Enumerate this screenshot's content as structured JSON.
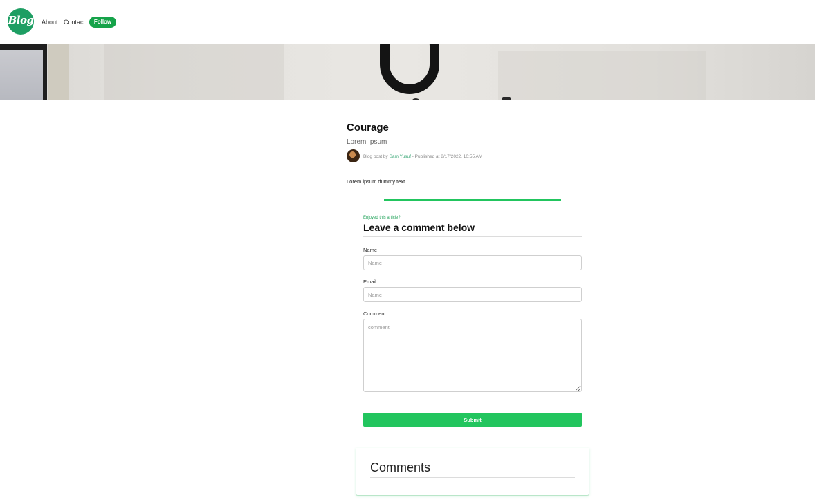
{
  "header": {
    "logo_text": "Blog",
    "nav": [
      {
        "label": "About"
      },
      {
        "label": "Contact"
      }
    ],
    "follow_label": "Follow"
  },
  "post": {
    "title": "Courage",
    "subtitle": "Lorem Ipsum",
    "meta_prefix": "Blog post by ",
    "author": "Sam Yusuf",
    "meta_suffix": " - Published at 8/17/2022, 10:55 AM",
    "body": "Lorem ipsum dummy text."
  },
  "comment_form": {
    "eyebrow": "Enjoyed this article?",
    "heading": "Leave a comment below",
    "name_label": "Name",
    "name_placeholder": "Name",
    "email_label": "Email",
    "email_placeholder": "Name",
    "comment_label": "Comment",
    "comment_placeholder": "comment",
    "submit_label": "Submit"
  },
  "comments": {
    "title": "Comments"
  },
  "colors": {
    "accent": "#22c55e",
    "brand": "#1e9e63",
    "follow": "#16a34a"
  }
}
